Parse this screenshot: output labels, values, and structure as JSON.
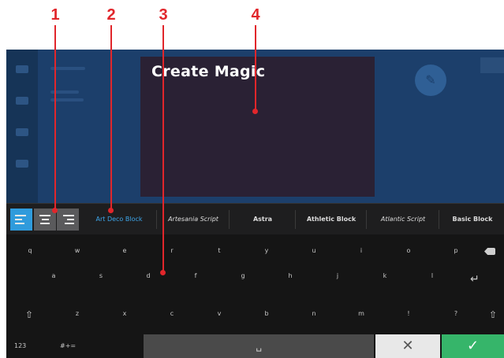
{
  "callouts": [
    "1",
    "2",
    "3",
    "4"
  ],
  "canvas": {
    "text": "Create Magic"
  },
  "toolbar": {
    "align_options": [
      "align-left",
      "align-center",
      "align-right"
    ],
    "selected_align": "align-left",
    "fonts": [
      "Art Deco Block",
      "Artesania Script",
      "Astra",
      "Athletic Block",
      "Atlantic Script",
      "Basic Block"
    ],
    "selected_font": "Art Deco Block"
  },
  "keyboard": {
    "row1": [
      "q",
      "w",
      "e",
      "r",
      "t",
      "y",
      "u",
      "i",
      "o",
      "p"
    ],
    "row2": [
      "a",
      "s",
      "d",
      "f",
      "g",
      "h",
      "j",
      "k",
      "l"
    ],
    "row3": [
      "z",
      "x",
      "c",
      "v",
      "b",
      "n",
      "m",
      "!",
      "?"
    ],
    "key_123": "123",
    "key_sym": "#+=",
    "space_glyph": "␣",
    "cancel_glyph": "✕",
    "ok_glyph": "✓",
    "enter_glyph": "↵",
    "shift_glyph": "⇧"
  },
  "colors": {
    "callout": "#e1262b",
    "selected_accent": "#2f9bdc",
    "ok_green": "#36b56a",
    "background_app": "#1c3f6b",
    "canvas": "#2a2134"
  }
}
